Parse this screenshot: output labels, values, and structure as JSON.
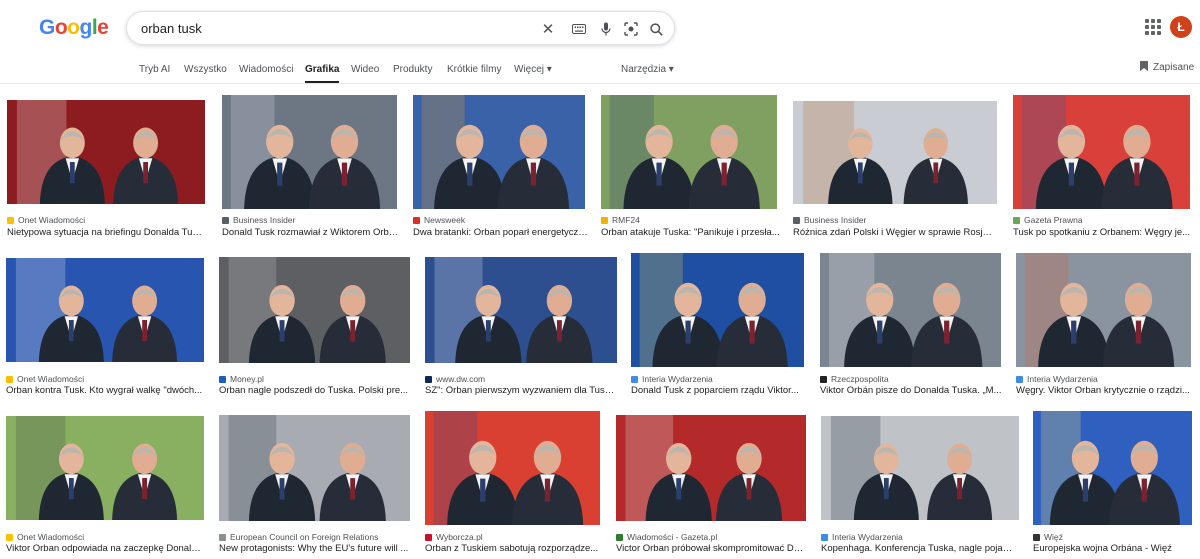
{
  "search": {
    "query": "orban tusk"
  },
  "logo": {
    "letters": [
      "G",
      "o",
      "o",
      "g",
      "l",
      "e"
    ],
    "colors": [
      "#4285f4",
      "#ea4335",
      "#fbbc05",
      "#4285f4",
      "#34a853",
      "#ea4335"
    ]
  },
  "account": {
    "initial": "Ł",
    "color": "#d0421a"
  },
  "tabs": [
    "Tryb AI",
    "Wszystko",
    "Wiadomości",
    "Grafika",
    "Wideo",
    "Produkty",
    "Krótkie filmy",
    "Więcej ▾"
  ],
  "active_tab": "Grafika",
  "tools_label": "Narzędzia ▾",
  "saved_label": "Zapisane",
  "results": [
    {
      "source": "Onet Wiadomości",
      "title": "Nietypowa sytuacja na briefingu Donalda Tuska...",
      "fav_color": "#f9c100"
    },
    {
      "source": "Business Insider",
      "title": "Donald Tusk rozmawiał z Wiktorem Orbánem...",
      "fav_color": "#5a5f66"
    },
    {
      "source": "Newsweek",
      "title": "Dwa bratanki: Orban poparł energetyczną...",
      "fav_color": "#d92d27"
    },
    {
      "source": "RMF24",
      "title": "Orban atakuje Tuska: \"Panikuje i przesła...",
      "fav_color": "#f0b400"
    },
    {
      "source": "Business Insider",
      "title": "Różnica zdań Polski i Węgier w sprawie Rosji. ...",
      "fav_color": "#5a5f66"
    },
    {
      "source": "Gazeta Prawna",
      "title": "Tusk po spotkaniu z Orbanem: Węgry je...",
      "fav_color": "#6aa84f"
    },
    {
      "source": "Onet Wiadomości",
      "title": "Orban kontra Tusk. Kto wygrał walkę \"dwóch...",
      "fav_color": "#f9c100"
    },
    {
      "source": "Money.pl",
      "title": "Orban nagle podszedł do Tuska. Polski pre...",
      "fav_color": "#1b5fbf"
    },
    {
      "source": "www.dw.com",
      "title": "SZ\": Orban pierwszym wyzwaniem dla Tuska...",
      "fav_color": "#0b2a55"
    },
    {
      "source": "Interia Wydarzenia",
      "title": "Donald Tusk z poparciem rządu Viktor...",
      "fav_color": "#3f8de0"
    },
    {
      "source": "Rzeczpospolita",
      "title": "Viktor Orbán pisze do Donalda Tuska. „M...",
      "fav_color": "#222222"
    },
    {
      "source": "Interia Wydarzenia",
      "title": "Węgry. Viktor Orban krytycznie o rządzi...",
      "fav_color": "#3f8de0"
    },
    {
      "source": "Onet Wiadomości",
      "title": "Viktor Orban odpowiada na zaczepkę Donald...",
      "fav_color": "#f9c100"
    },
    {
      "source": "European Council on Foreign Relations",
      "title": "New protagonists: Why the EU's future will ...",
      "fav_color": "#8a8f96"
    },
    {
      "source": "Wyborcza.pl",
      "title": "Orban z Tuskiem sabotują rozporządze...",
      "fav_color": "#c8102e"
    },
    {
      "source": "Wiadomości - Gazeta.pl",
      "title": "Victor Orban próbował skompromitować Do...",
      "fav_color": "#2e7d32"
    },
    {
      "source": "Interia Wydarzenia",
      "title": "Kopenhaga. Konferencja Tuska, nagle pojawi...",
      "fav_color": "#3f8de0"
    },
    {
      "source": "Więź",
      "title": "Europejska wojna Orbána - Więź",
      "fav_color": "#333333"
    }
  ],
  "thumb_scenes": [
    {
      "bg": "#8c1c20",
      "accent": "#f2f2f2"
    },
    {
      "bg": "#6d7784",
      "accent": "#d8dde3"
    },
    {
      "bg": "#3a62a8",
      "accent": "#e9a020"
    },
    {
      "bg": "#7fa060",
      "accent": "#2c3f74"
    },
    {
      "bg": "#c9cdd3",
      "accent": "#b86b2f"
    },
    {
      "bg": "#d9403a",
      "accent": "#2f5ca8"
    },
    {
      "bg": "#2855b0",
      "accent": "#e8edf5"
    },
    {
      "bg": "#5d5f63",
      "accent": "#c9c9c9"
    },
    {
      "bg": "#2e4f8f",
      "accent": "#dfe5ef"
    },
    {
      "bg": "#1f4fa3",
      "accent": "#e6d24a"
    },
    {
      "bg": "#7b8590",
      "accent": "#f0f0f0"
    },
    {
      "bg": "#8a94a0",
      "accent": "#d65a30"
    },
    {
      "bg": "#88b060",
      "accent": "#3f4650"
    },
    {
      "bg": "#a8acb2",
      "accent": "#2d3642"
    },
    {
      "bg": "#d94032",
      "accent": "#2c4a8a"
    },
    {
      "bg": "#b42a2a",
      "accent": "#e1e4e8"
    },
    {
      "bg": "#bfc3c8",
      "accent": "#1e2a3a"
    },
    {
      "bg": "#2f5fbf",
      "accent": "#f3e27a"
    }
  ]
}
